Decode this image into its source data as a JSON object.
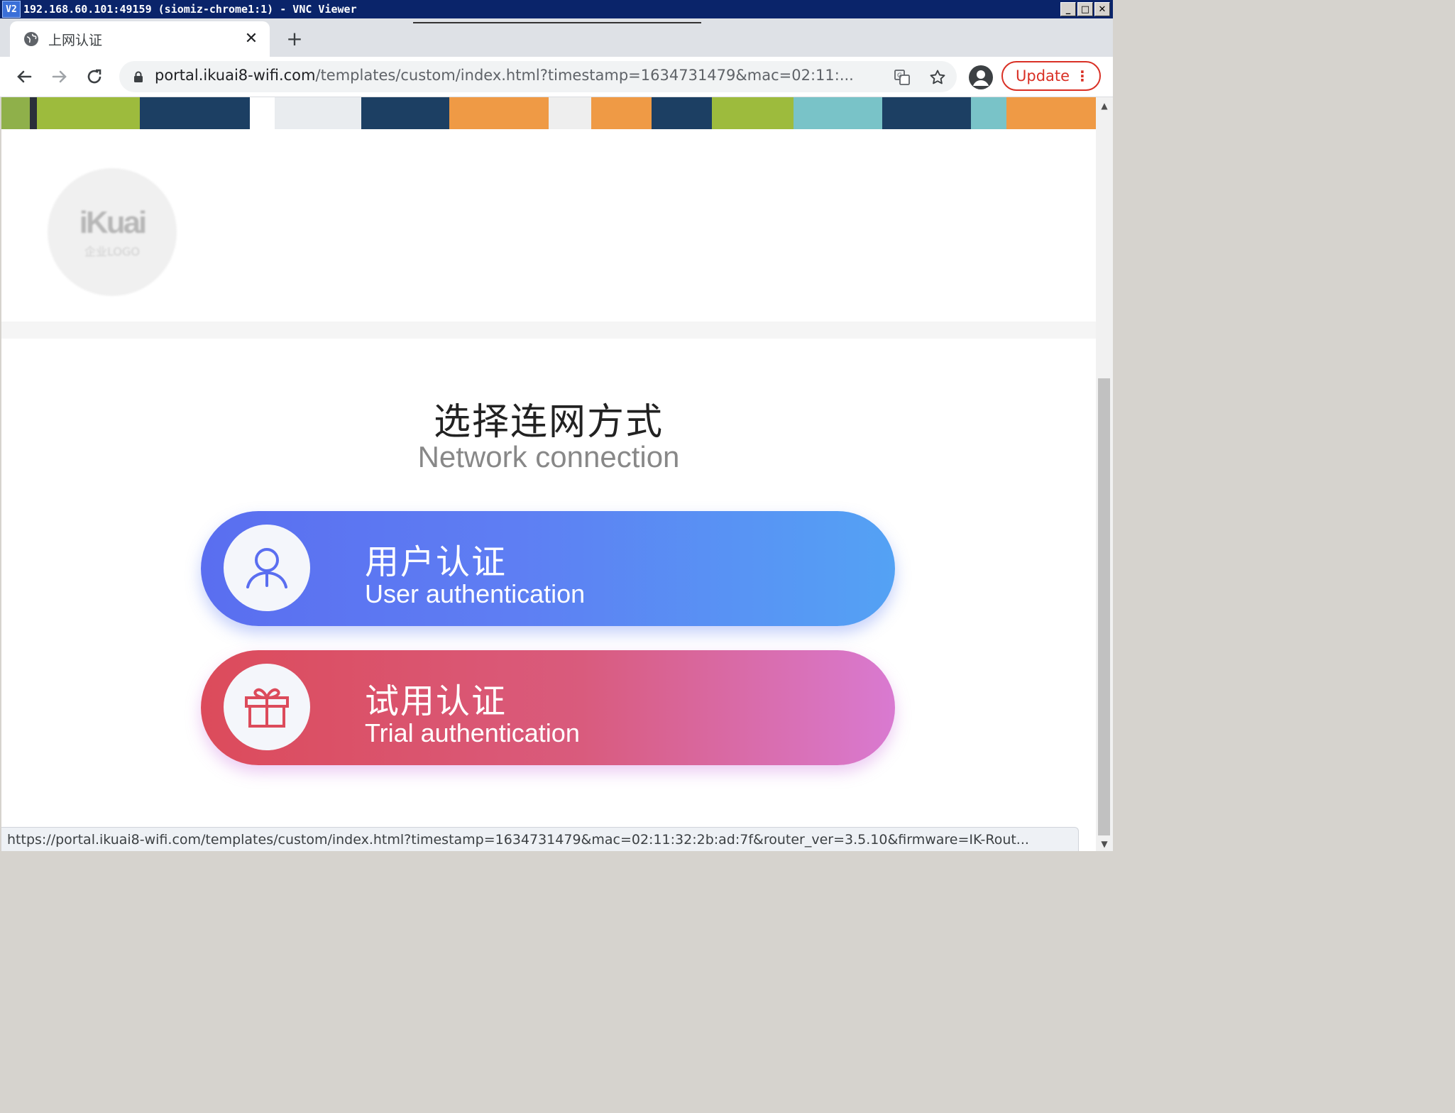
{
  "vnc": {
    "logo": "V2",
    "title": "192.168.60.101:49159 (siomiz-chrome1:1) - VNC Viewer",
    "controls": [
      "_",
      "□",
      "✕"
    ]
  },
  "browser": {
    "tab": {
      "title": "上网认证",
      "close": "✕"
    },
    "new_tab": "+",
    "address": {
      "host": "portal.ikuai8-wifi.com",
      "path": "/templates/custom/index.html?timestamp=1634731479&mac=02:11:..."
    },
    "update_label": "Update",
    "update_menu": "⋮"
  },
  "page": {
    "logo": {
      "text": "iKuai",
      "sub": "企业LOGO"
    },
    "heading": {
      "cn": "选择连网方式",
      "en": "Network connection"
    },
    "options": [
      {
        "cn": "用户认证",
        "en": "User authentication",
        "icon": "user-icon"
      },
      {
        "cn": "试用认证",
        "en": "Trial authentication",
        "icon": "gift-icon"
      }
    ]
  },
  "status_url": "https://portal.ikuai8-wifi.com/templates/custom/index.html?timestamp=1634731479&mac=02:11:32:2b:ad:7f&router_ver=3.5.10&firmware=IK-Rout...",
  "colors": {
    "user_gradient": [
      "#5a6ef0",
      "#54a2f4"
    ],
    "trial_gradient": [
      "#dc4b5b",
      "#d97ad1"
    ],
    "update_red": "#d93025"
  }
}
